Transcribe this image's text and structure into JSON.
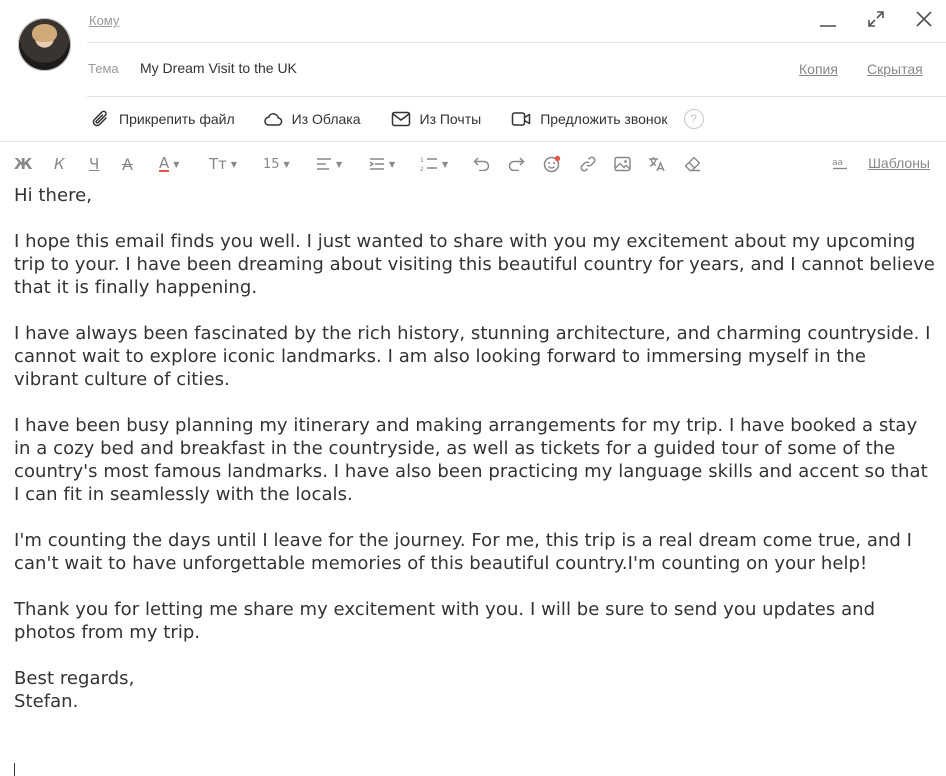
{
  "header": {
    "to_label": "Кому",
    "subject_label": "Тема",
    "subject_value": "My Dream Visit to the UK",
    "cc_label": "Копия",
    "bcc_label": "Скрытая"
  },
  "window_controls": [
    "minimize-icon",
    "expand-icon",
    "close-icon"
  ],
  "attachments": {
    "attach_file": "Прикрепить файл",
    "from_cloud": "Из Облака",
    "from_mail": "Из Почты",
    "suggest_call": "Предложить звонок",
    "help": "?"
  },
  "toolbar": {
    "bold": "Ж",
    "italic": "К",
    "underline": "Ч",
    "strike": "А",
    "font_color": "А",
    "font_size_label": "Тт",
    "font_size": "15",
    "templates": "Шаблоны",
    "accent_color": "#e8564a"
  },
  "message": {
    "paragraphs": [
      "Hi there,",
      "I hope this email finds you well. I just wanted to share with you my excitement about my upcoming trip to your. I have been dreaming about visiting this beautiful country for years, and I cannot believe that it is finally happening.",
      "I have always been fascinated by the rich history, stunning architecture, and charming countryside. I cannot wait to explore iconic landmarks. I am also looking forward to immersing myself in the vibrant culture of cities.",
      "I have been busy planning my itinerary and making arrangements for my trip. I have booked a stay in a cozy bed and breakfast in the countryside, as well as tickets for a guided tour of some of the country's most famous landmarks. I have also been practicing my language skills and accent so that I can fit in seamlessly with the locals.",
      "I'm counting the days until I leave for the journey. For me, this trip is a real dream come true, and I can't wait to have unforgettable memories of this beautiful country.I'm counting on your help!",
      "Thank you for letting me share my excitement with you. I will be sure to send you updates and photos from my trip.",
      "Best regards,",
      "Stefan."
    ]
  }
}
